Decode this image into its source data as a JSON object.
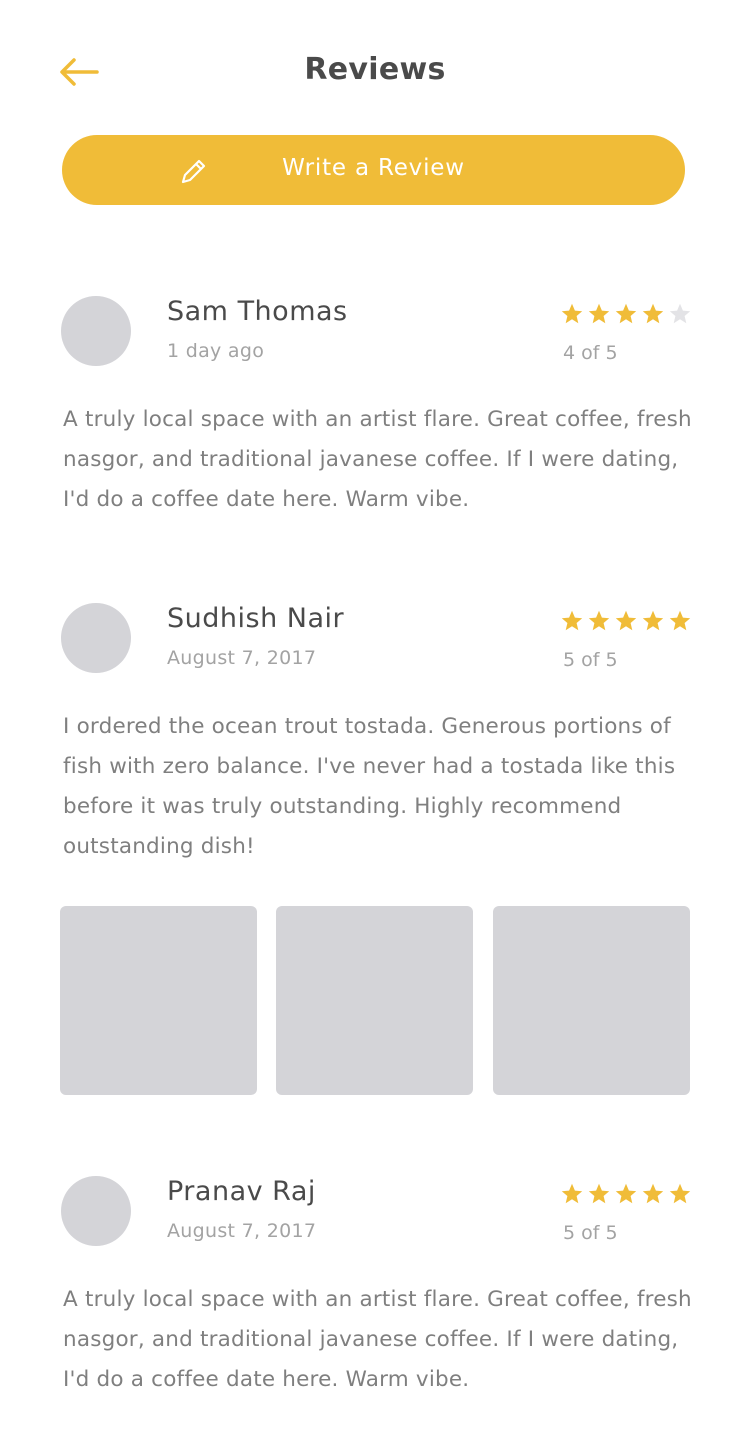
{
  "header": {
    "title": "Reviews",
    "back_icon": "arrow-left-icon",
    "accent_color": "#f0bc38"
  },
  "write_review": {
    "label": "Write a Review",
    "icon": "pencil-icon"
  },
  "reviews": [
    {
      "name": "Sam Thomas",
      "date": "1 day ago",
      "rating": 4,
      "rating_text": "4 of 5",
      "text": "A truly local space with an artist flare. Great coffee, fresh nasgor, and traditional javanese coffee. If I were dating, I'd do a coffee date here. Warm vibe."
    },
    {
      "name": "Sudhish Nair",
      "date": "August 7, 2017",
      "rating": 5,
      "rating_text": "5 of 5",
      "text": "I ordered the ocean trout tostada.  Generous portions of fish with zero balance. I've never had a tostada like this before it was truly outstanding. Highly recommend outstanding dish!",
      "photo_count": 3
    },
    {
      "name": "Pranav Raj",
      "date": "August 7, 2017",
      "rating": 5,
      "rating_text": "5 of 5",
      "text": "A truly local space with an artist flare. Great coffee, fresh nasgor, and traditional javanese coffee. If I were dating, I'd do a coffee date here. Warm vibe."
    }
  ]
}
